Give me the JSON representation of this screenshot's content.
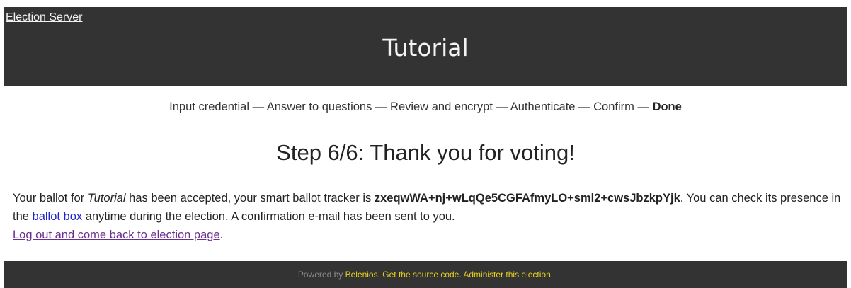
{
  "header": {
    "server_link": "Election Server",
    "title": "Tutorial"
  },
  "steps": {
    "items": [
      "Input credential",
      "Answer to questions",
      "Review and encrypt",
      "Authenticate",
      "Confirm"
    ],
    "current": "Done",
    "separator": " — "
  },
  "step_title": "Step 6/6: Thank you for voting!",
  "message": {
    "part1": "Your ballot for ",
    "election_name": "Tutorial",
    "part2": " has been accepted, your smart ballot tracker is ",
    "tracker": "zxeqwWA+nj+wLqQe5CGFAfmyLO+sml2+cwsJbzkpYjk",
    "part3": ". You can check its presence in the ",
    "ballot_box_link": "ballot box",
    "part4": " anytime during the election. A confirmation e-mail has been sent to you.",
    "logout_link": "Log out and come back to election page",
    "logout_suffix": "."
  },
  "footer": {
    "powered_by": "Powered by ",
    "belenios_link": "Belenios",
    "sep1": ". ",
    "source_link": "Get the source code",
    "sep2": ". ",
    "admin_link": "Administer this election",
    "end": "."
  }
}
